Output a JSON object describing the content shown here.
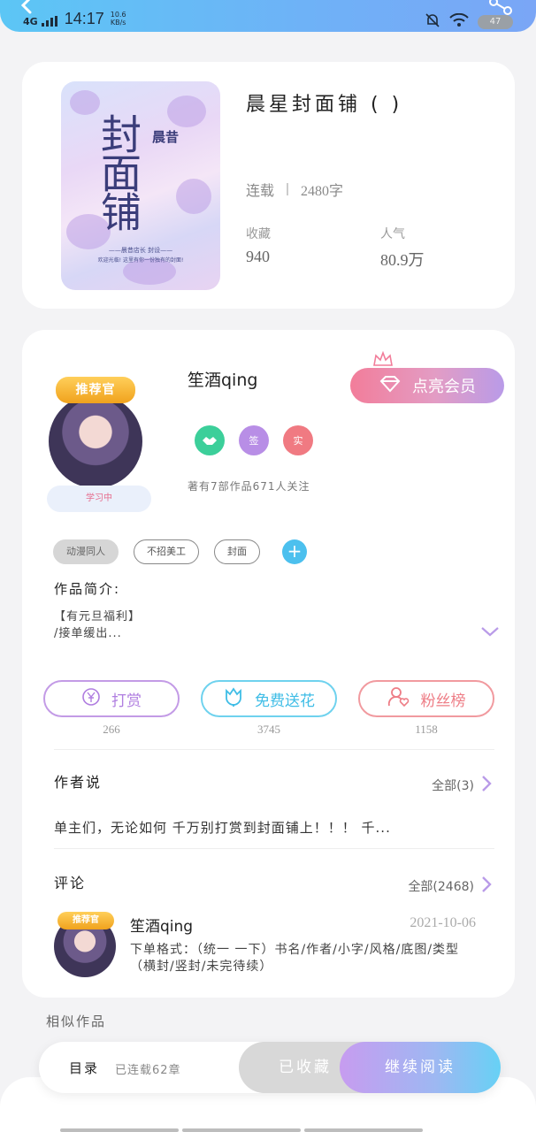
{
  "status_bar": {
    "network": "4G",
    "time": "14:17",
    "speed_value": "10.6",
    "speed_unit": "KB/s",
    "battery": "47"
  },
  "book": {
    "title": "晨星封面铺 ( )",
    "cover_title": "封面铺",
    "cover_subtitle": "晨昔",
    "cover_line1": "——晨昔店长 封设——",
    "cover_line2": "欢迎光临! 这里有你一份独有的封面!",
    "status": "连载",
    "word_count": "2480字",
    "favorites_label": "收藏",
    "favorites_value": "940",
    "popularity_label": "人气",
    "popularity_value": "80.9万"
  },
  "author": {
    "name": "笙酒qing",
    "recommend_badge": "推荐官",
    "learning_badge": "学习中",
    "vip_button": "点亮会员",
    "role_badges": [
      "",
      "签",
      "实"
    ],
    "works_line": "著有7部作品671人关注",
    "tags": [
      "动漫同人",
      "不招美工",
      "封面"
    ],
    "add_tag": "+"
  },
  "intro": {
    "label": "作品简介:",
    "line1": "【有元旦福利】",
    "line2": "/接单缓出..."
  },
  "actions": [
    {
      "label": "打赏",
      "count": "266",
      "icon": "yen-icon"
    },
    {
      "label": "免费送花",
      "count": "3745",
      "icon": "flower-icon"
    },
    {
      "label": "粉丝榜",
      "count": "1158",
      "icon": "fans-icon"
    }
  ],
  "author_says": {
    "title": "作者说",
    "more": "全部(3)",
    "text": "单主们，无论如何 千万别打赏到封面铺上！！！ 千..."
  },
  "comments": {
    "title": "评论",
    "more": "全部(2468)",
    "item": {
      "badge": "推荐官",
      "name": "笙酒qing",
      "date": "2021-10-06",
      "text": "下单格式：（统一 一下）书名/作者/小字/风格/底图/类型（横封/竖封/未完待续）"
    }
  },
  "similar_title": "相似作品",
  "bottom_bar": {
    "toc_label": "目录",
    "toc_info": "已连载62章",
    "favorited": "已收藏",
    "continue": "继续阅读"
  },
  "colors": {
    "accent_blue": "#4cc0ee",
    "vip_pink": "#f27d9a",
    "reward_purple": "#b07ee0",
    "flower_blue": "#3fbde6",
    "fans_red": "#ee7d86"
  }
}
